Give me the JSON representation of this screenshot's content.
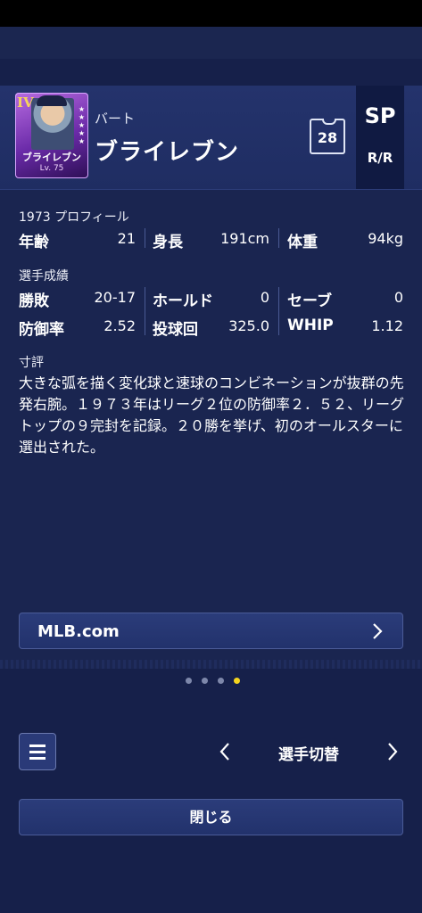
{
  "player": {
    "card_rank": "IV",
    "card_name": "ブライレブン",
    "card_level": "Lv. 75",
    "first_name": "バート",
    "last_name": "ブライレブン",
    "uniform_number": "28",
    "position": "SP",
    "bats_throws": "R/R"
  },
  "profile": {
    "heading": "1973 プロフィール",
    "age_label": "年齢",
    "age_value": "21",
    "height_label": "身長",
    "height_value": "191cm",
    "weight_label": "体重",
    "weight_value": "94kg"
  },
  "record": {
    "heading": "選手成績",
    "wl_label": "勝敗",
    "wl_value": "20-17",
    "hold_label": "ホールド",
    "hold_value": "0",
    "save_label": "セーブ",
    "save_value": "0",
    "era_label": "防御率",
    "era_value": "2.52",
    "ip_label": "投球回",
    "ip_value": "325.0",
    "whip_label": "WHIP",
    "whip_value": "1.12"
  },
  "review": {
    "heading": "寸評",
    "text": "大きな弧を描く変化球と速球のコンビネーションが抜群の先発右腕。１９７３年はリーグ２位の防御率２．５２、リーグトップの９完封を記録。２０勝を挙げ、初のオールスターに選出された。"
  },
  "link": {
    "label": "MLB.com"
  },
  "pager": {
    "count": 4,
    "active_index": 3
  },
  "switcher": {
    "label": "選手切替"
  },
  "close": {
    "label": "閉じる"
  },
  "icons": [
    "menu-icon",
    "chevron-left-icon",
    "chevron-right-icon",
    "uniform-icon"
  ],
  "colors": {
    "background": "#1a2550",
    "active_dot": "#f4d41e",
    "card": "#8a3ccc"
  }
}
